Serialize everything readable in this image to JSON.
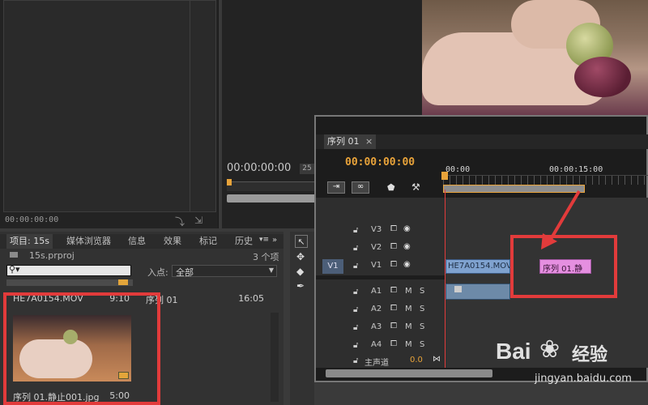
{
  "program_monitor": {
    "timecode": "00:00:00:00",
    "zoom": "25"
  },
  "source_monitor": {
    "timecode": "00:00:00:00"
  },
  "project_panel": {
    "tabs": [
      "项目: 15s",
      "媒体浏览器",
      "信息",
      "效果",
      "标记",
      "历史"
    ],
    "project_file": "15s.prproj",
    "item_count": "3 个项",
    "inpoint_label": "入点:",
    "inpoint_value": "全部",
    "items": [
      {
        "name": "HE7A0154.MOV",
        "duration": "9:10"
      },
      {
        "name": "序列 01",
        "duration": "16:05"
      },
      {
        "name": "序列 01.静止001.jpg",
        "duration": "5:00"
      }
    ]
  },
  "timeline": {
    "tab_label": "序列 01",
    "timecode": "00:00:00:00",
    "ruler": [
      "00:00",
      "00:00:15:00"
    ],
    "tracks": [
      {
        "id": "V3"
      },
      {
        "id": "V2"
      },
      {
        "id": "V1",
        "source": "V1"
      },
      {
        "id": "A1",
        "m": "M",
        "s": "S"
      },
      {
        "id": "A2",
        "m": "M",
        "s": "S"
      },
      {
        "id": "A3",
        "m": "M",
        "s": "S"
      },
      {
        "id": "A4",
        "m": "M",
        "s": "S"
      }
    ],
    "master_label": "主声道",
    "master_value": "0.0",
    "clips": {
      "video1": "HE7A0154.MOV [V]",
      "still": "序列 01.静"
    }
  },
  "watermark": {
    "brand": "Bai",
    "brand_cn": "经验",
    "url": "jingyan.baidu.com"
  },
  "colors": {
    "timecode": "#e8a33a",
    "video_clip": "#7fa2cf",
    "still_clip": "#e58fe0",
    "playhead": "#e23b3b",
    "annotation": "#e23b3b"
  }
}
